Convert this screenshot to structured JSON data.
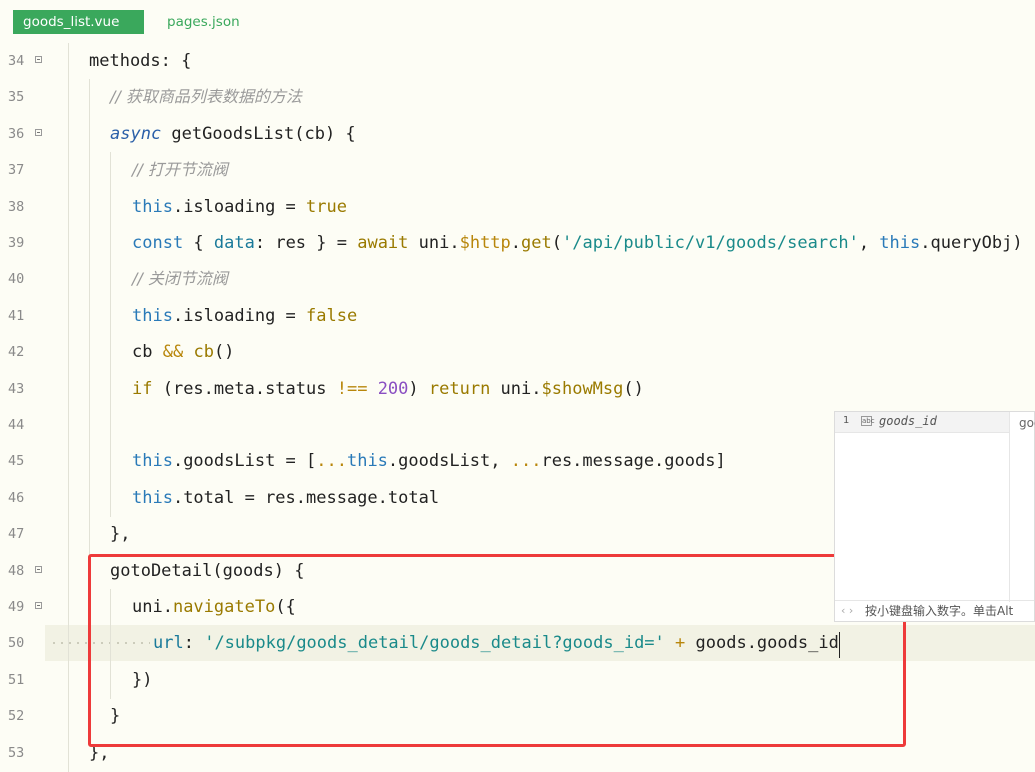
{
  "tabs": [
    {
      "label": "goods_list.vue",
      "active": true
    },
    {
      "label": "pages.json",
      "active": false
    }
  ],
  "colors": {
    "accent": "#3aa85c",
    "highlight_box": "#ee3a3a",
    "editor_bg": "#fdfdf5"
  },
  "lines": [
    {
      "n": "34",
      "fold": true,
      "indent": 89,
      "tokens": [
        [
          "plain",
          "methods"
        ],
        [
          "plain",
          ": {"
        ]
      ]
    },
    {
      "n": "35",
      "fold": false,
      "indent": 110,
      "tokens": [
        [
          "cmt",
          "// 获取商品列表数据的方法"
        ]
      ]
    },
    {
      "n": "36",
      "fold": true,
      "indent": 110,
      "tokens": [
        [
          "kwi",
          "async"
        ],
        [
          "plain",
          " getGoodsList(cb) {"
        ]
      ]
    },
    {
      "n": "37",
      "fold": false,
      "indent": 132,
      "tokens": [
        [
          "cmt",
          "// 打开节流阀"
        ]
      ]
    },
    {
      "n": "38",
      "fold": false,
      "indent": 132,
      "tokens": [
        [
          "kw",
          "this"
        ],
        [
          "plain",
          ".isloading = "
        ],
        [
          "fn",
          "true"
        ]
      ]
    },
    {
      "n": "39",
      "fold": false,
      "indent": 132,
      "tokens": [
        [
          "kw",
          "const"
        ],
        [
          "plain",
          " { "
        ],
        [
          "prop",
          "data"
        ],
        [
          "plain",
          ": res } = "
        ],
        [
          "fn",
          "await"
        ],
        [
          "plain",
          " uni."
        ],
        [
          "op",
          "$http"
        ],
        [
          "plain",
          "."
        ],
        [
          "fn",
          "get"
        ],
        [
          "plain",
          "("
        ],
        [
          "str",
          "'/api/public/v1/goods/search'"
        ],
        [
          "plain",
          ", "
        ],
        [
          "kw",
          "this"
        ],
        [
          "plain",
          ".queryObj)"
        ]
      ]
    },
    {
      "n": "40",
      "fold": false,
      "indent": 132,
      "tokens": [
        [
          "cmt",
          "// 关闭节流阀"
        ]
      ]
    },
    {
      "n": "41",
      "fold": false,
      "indent": 132,
      "tokens": [
        [
          "kw",
          "this"
        ],
        [
          "plain",
          ".isloading = "
        ],
        [
          "fn",
          "false"
        ]
      ]
    },
    {
      "n": "42",
      "fold": false,
      "indent": 132,
      "tokens": [
        [
          "plain",
          "cb "
        ],
        [
          "op",
          "&&"
        ],
        [
          "plain",
          " "
        ],
        [
          "fn",
          "cb"
        ],
        [
          "plain",
          "()"
        ]
      ]
    },
    {
      "n": "43",
      "fold": false,
      "indent": 132,
      "tokens": [
        [
          "fn",
          "if"
        ],
        [
          "plain",
          " (res.meta.status "
        ],
        [
          "op",
          "!=="
        ],
        [
          "plain",
          " "
        ],
        [
          "num",
          "200"
        ],
        [
          "plain",
          ") "
        ],
        [
          "fn",
          "return"
        ],
        [
          "plain",
          " uni."
        ],
        [
          "fn",
          "$showMsg"
        ],
        [
          "plain",
          "()"
        ]
      ]
    },
    {
      "n": "44",
      "fold": false,
      "indent": 132,
      "tokens": []
    },
    {
      "n": "45",
      "fold": false,
      "indent": 132,
      "tokens": [
        [
          "kw",
          "this"
        ],
        [
          "plain",
          ".goodsList = ["
        ],
        [
          "op",
          "..."
        ],
        [
          "kw",
          "this"
        ],
        [
          "plain",
          ".goodsList, "
        ],
        [
          "op",
          "..."
        ],
        [
          "plain",
          "res.message.goods]"
        ]
      ]
    },
    {
      "n": "46",
      "fold": false,
      "indent": 132,
      "tokens": [
        [
          "kw",
          "this"
        ],
        [
          "plain",
          ".total = res.message.total"
        ]
      ]
    },
    {
      "n": "47",
      "fold": false,
      "indent": 110,
      "tokens": [
        [
          "plain",
          "},"
        ]
      ]
    },
    {
      "n": "48",
      "fold": true,
      "indent": 110,
      "tokens": [
        [
          "plain",
          "gotoDetail(goods) {"
        ]
      ]
    },
    {
      "n": "49",
      "fold": true,
      "indent": 132,
      "tokens": [
        [
          "plain",
          "uni."
        ],
        [
          "fn",
          "navigateTo"
        ],
        [
          "plain",
          "({"
        ]
      ]
    },
    {
      "n": "50",
      "fold": false,
      "indent": 153,
      "current": true,
      "tokens": [
        [
          "prop",
          "url"
        ],
        [
          "plain",
          ": "
        ],
        [
          "str",
          "'/subpkg/goods_detail/goods_detail?goods_id='"
        ],
        [
          "plain",
          " "
        ],
        [
          "op",
          "+"
        ],
        [
          "plain",
          " goods.goods_id"
        ]
      ]
    },
    {
      "n": "51",
      "fold": false,
      "indent": 132,
      "tokens": [
        [
          "plain",
          "})"
        ]
      ]
    },
    {
      "n": "52",
      "fold": false,
      "indent": 110,
      "tokens": [
        [
          "plain",
          "}"
        ]
      ]
    },
    {
      "n": "53",
      "fold": false,
      "indent": 89,
      "tokens": [
        [
          "plain",
          "},"
        ]
      ]
    }
  ],
  "suggest": {
    "index": "1",
    "icon": "abc",
    "label": "goods_id",
    "detail": "goods_id",
    "footer_arrows": "‹ ›",
    "footer_hint": "按小键盘输入数字。单击Alt"
  }
}
